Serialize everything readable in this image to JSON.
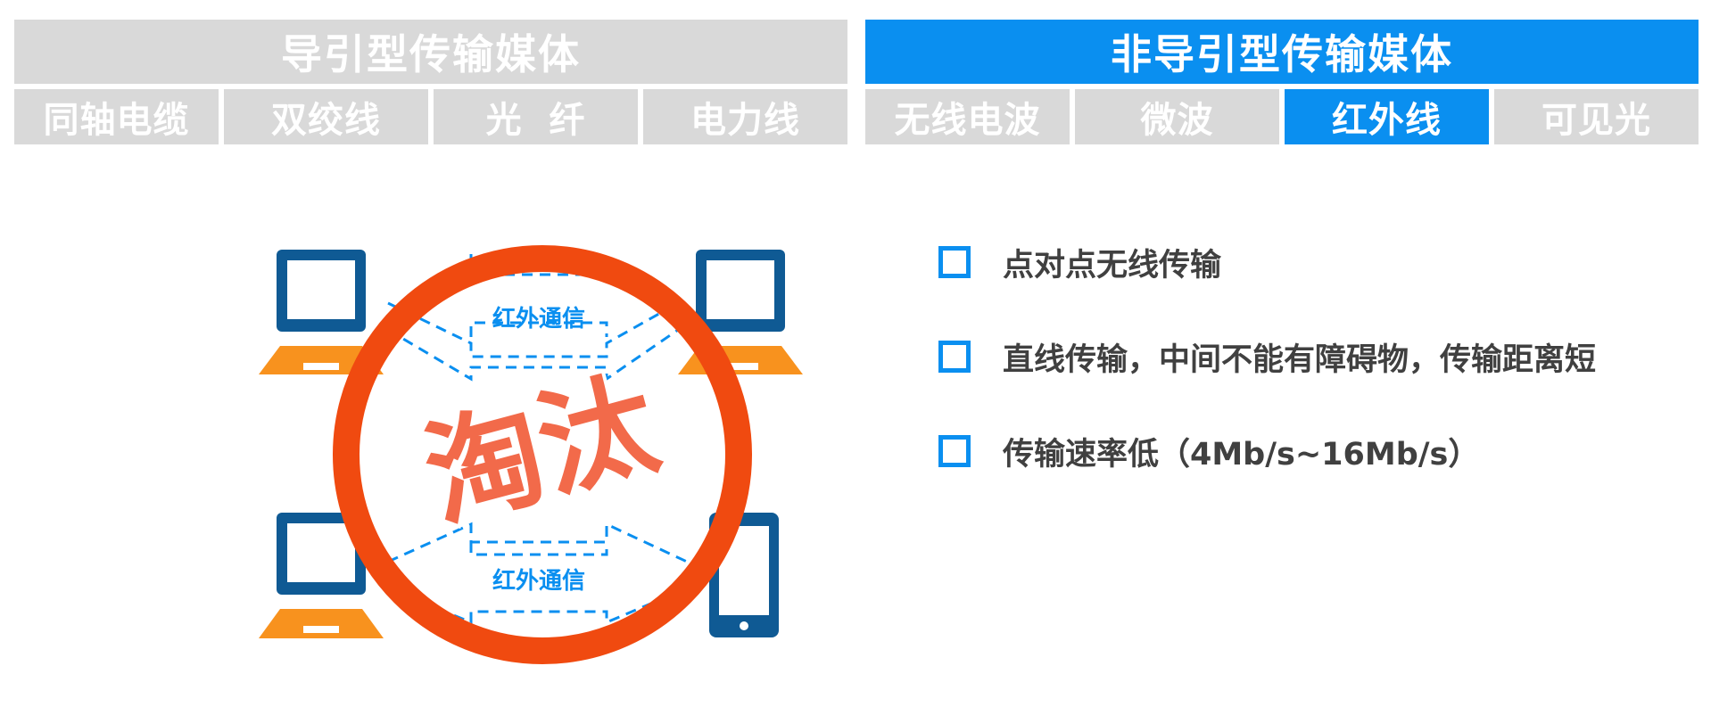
{
  "guided": {
    "title": "导引型传输媒体",
    "tabs": [
      {
        "label": "同轴电缆",
        "active": false
      },
      {
        "label": "双绞线",
        "active": false
      },
      {
        "label": "光  纤",
        "active": false
      },
      {
        "label": "电力线",
        "active": false
      }
    ]
  },
  "unguided": {
    "title": "非导引型传输媒体",
    "tabs": [
      {
        "label": "无线电波",
        "active": false
      },
      {
        "label": "微波",
        "active": false
      },
      {
        "label": "红外线",
        "active": true
      },
      {
        "label": "可见光",
        "active": false
      }
    ]
  },
  "illustration": {
    "link_label_top": "红外通信",
    "link_label_bottom": "红外通信",
    "stamp_text": "淘汰"
  },
  "checklist": [
    {
      "text": "点对点无线传输"
    },
    {
      "text": "直线传输，中间不能有障碍物，传输距离短"
    },
    {
      "text": "传输速率低（4Mb/s~16Mb/s）"
    }
  ],
  "colors": {
    "accent": "#0a8ff0",
    "inactive": "#d9d9d9",
    "stamp": "#f04a10",
    "device_dark": "#0f5a94",
    "device_base": "#f8921e",
    "text": "#404040"
  }
}
